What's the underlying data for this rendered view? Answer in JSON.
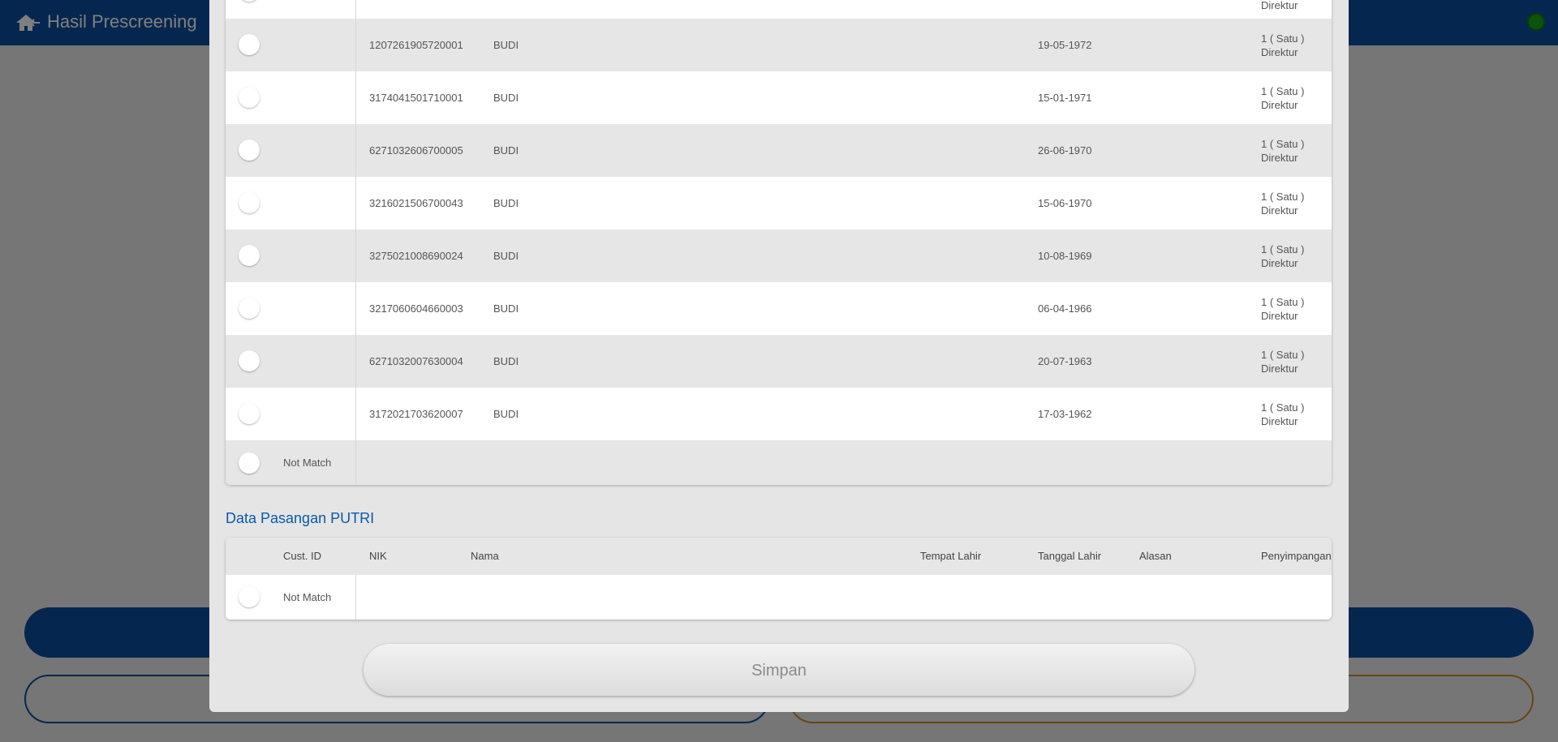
{
  "header": {
    "title": "Hasil Prescreening",
    "back_icon": "home-back-icon",
    "status_color": "#1aa51a"
  },
  "top_table": {
    "partial_row_penyimpangan": "Direktur",
    "rows": [
      {
        "nik": "1207261905720001",
        "nama": "BUDI",
        "tanggal_lahir": "19-05-1972",
        "penyimpangan_1": "1 ( Satu )",
        "penyimpangan_2": "Direktur"
      },
      {
        "nik": "3174041501710001",
        "nama": "BUDI",
        "tanggal_lahir": "15-01-1971",
        "penyimpangan_1": "1 ( Satu )",
        "penyimpangan_2": "Direktur"
      },
      {
        "nik": "6271032606700005",
        "nama": "BUDI",
        "tanggal_lahir": "26-06-1970",
        "penyimpangan_1": "1 ( Satu )",
        "penyimpangan_2": "Direktur"
      },
      {
        "nik": "3216021506700043",
        "nama": "BUDI",
        "tanggal_lahir": "15-06-1970",
        "penyimpangan_1": "1 ( Satu )",
        "penyimpangan_2": "Direktur"
      },
      {
        "nik": "3275021008690024",
        "nama": "BUDI",
        "tanggal_lahir": "10-08-1969",
        "penyimpangan_1": "1 ( Satu )",
        "penyimpangan_2": "Direktur"
      },
      {
        "nik": "3217060604660003",
        "nama": "BUDI",
        "tanggal_lahir": "06-04-1966",
        "penyimpangan_1": "1 ( Satu )",
        "penyimpangan_2": "Direktur"
      },
      {
        "nik": "6271032007630004",
        "nama": "BUDI",
        "tanggal_lahir": "20-07-1963",
        "penyimpangan_1": "1 ( Satu )",
        "penyimpangan_2": "Direktur"
      },
      {
        "nik": "3172021703620007",
        "nama": "BUDI",
        "tanggal_lahir": "17-03-1962",
        "penyimpangan_1": "1 ( Satu )",
        "penyimpangan_2": "Direktur"
      }
    ],
    "not_match_label": "Not Match"
  },
  "pasangan_section": {
    "title": "Data Pasangan PUTRI",
    "columns": {
      "cust_id": "Cust. ID",
      "nik": "NIK",
      "nama": "Nama",
      "tempat_lahir": "Tempat Lahir",
      "tanggal_lahir": "Tanggal Lahir",
      "alasan": "Alasan",
      "penyimpangan": "Penyimpangan"
    },
    "not_match_label": "Not Match"
  },
  "actions": {
    "save_label": "Simpan"
  }
}
